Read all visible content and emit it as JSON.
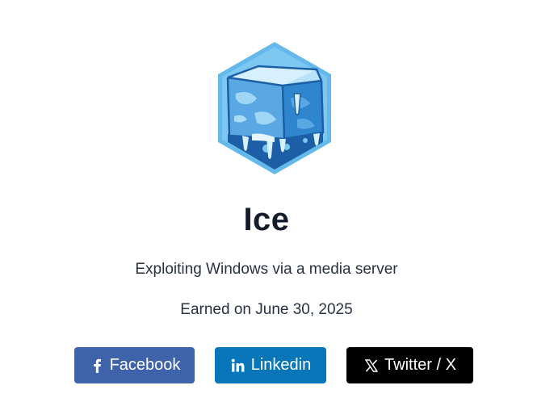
{
  "badge": {
    "name": "Ice",
    "description": "Exploiting Windows via a media server",
    "earned_text": "Earned on June 30, 2025",
    "icon": "ice-cube-hexagon-badge"
  },
  "share": {
    "facebook": {
      "label": "Facebook",
      "icon": "facebook-icon",
      "color": "#3f63ab"
    },
    "linkedin": {
      "label": "Linkedin",
      "icon": "linkedin-icon",
      "color": "#0876b8"
    },
    "twitter": {
      "label": "Twitter / X",
      "icon": "x-icon",
      "color": "#000000"
    }
  }
}
